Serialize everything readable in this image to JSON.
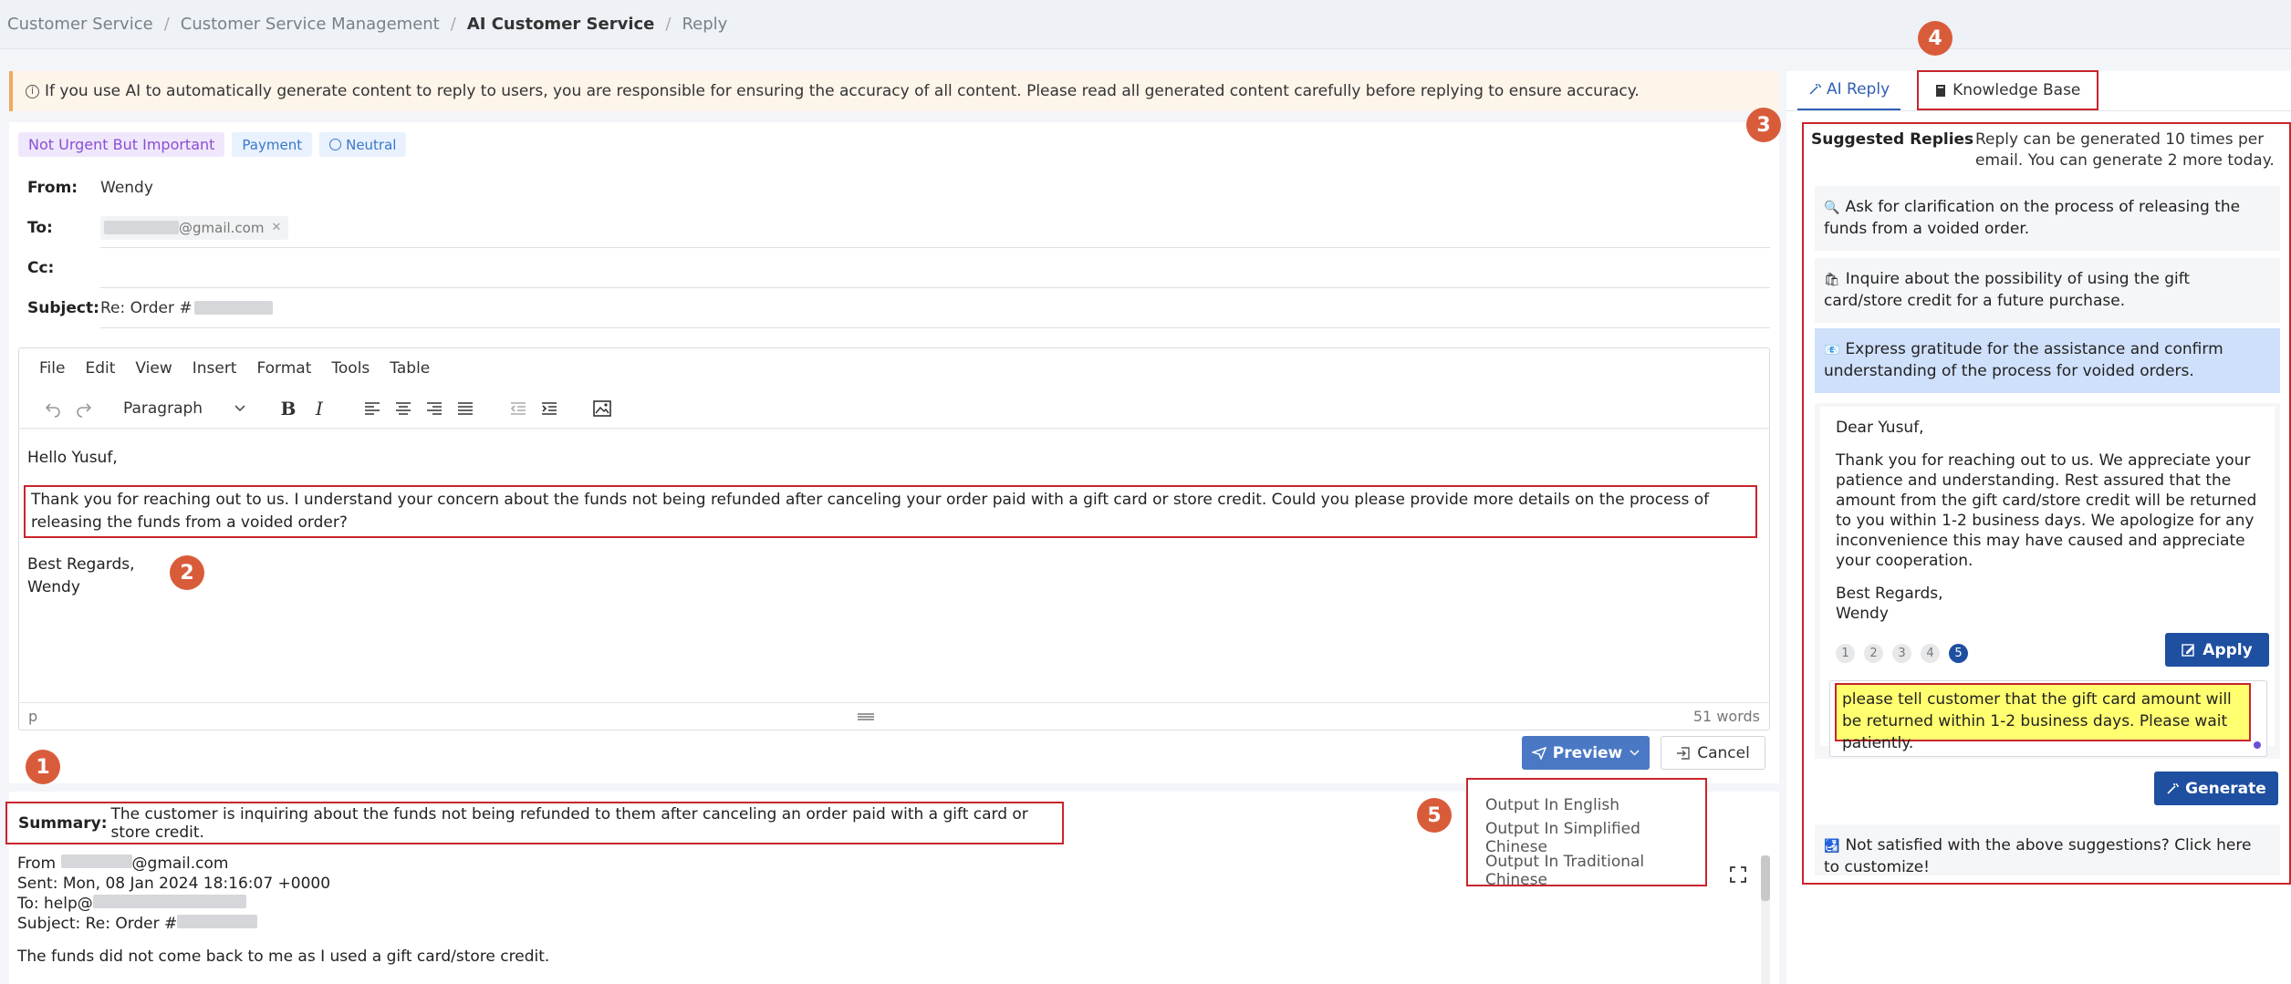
{
  "breadcrumb": {
    "items": [
      "Customer Service",
      "Customer Service Management",
      "AI Customer Service",
      "Reply"
    ]
  },
  "notice": {
    "text": "If you use AI to automatically generate content to reply to users, you are responsible for ensuring the accuracy of all content. Please read all generated content carefully before replying to ensure accuracy."
  },
  "tags": {
    "priority": "Not Urgent But Important",
    "category": "Payment",
    "sentiment": "Neutral"
  },
  "fields": {
    "from_label": "From:",
    "from_value": "Wendy",
    "to_label": "To:",
    "to_value": "@gmail.com",
    "cc_label": "Cc:",
    "subject_label": "Subject:",
    "subject_value": "Re: Order #"
  },
  "editor": {
    "menu": [
      "File",
      "Edit",
      "View",
      "Insert",
      "Format",
      "Tools",
      "Table"
    ],
    "block_format": "Paragraph",
    "greeting": "Hello Yusuf,",
    "body": "Thank you for reaching out to us. I understand your concern about the funds not being refunded after canceling your order paid with a gift card or store credit. Could you please provide more details on the process of releasing the funds from a voided order?",
    "closing": "Best Regards,",
    "signature": "Wendy",
    "element_path": "p",
    "word_count": "51 words"
  },
  "actions": {
    "preview": "Preview",
    "cancel": "Cancel"
  },
  "preview_menu": {
    "options": [
      "Output In English",
      "Output In Simplified Chinese",
      "Output In Traditional Chinese"
    ]
  },
  "summary": {
    "label": "Summary:",
    "text": "The customer is inquiring about the funds not being refunded to them after canceling an order paid with a gift card or store credit."
  },
  "original_email": {
    "from": "From",
    "from_domain": "@gmail.com",
    "sent": "Sent: Mon, 08 Jan 2024 18:16:07 +0000",
    "to": "To: help@",
    "subject": "Subject: Re: Order #",
    "body": "The funds did not come back to me as I used a gift card/store credit."
  },
  "badges": [
    "1",
    "2",
    "3",
    "4",
    "5"
  ],
  "right_panel": {
    "tab_ai": "AI Reply",
    "tab_kb": "Knowledge Base",
    "suggested_title": "Suggested Replies",
    "quota_text": "Reply can be generated 10 times per email. You can generate 2 more today.",
    "suggestions": [
      {
        "icon": "🔍",
        "text": "Ask for clarification on the process of releasing the funds from a voided order."
      },
      {
        "icon": "🛍",
        "text": "Inquire about the possibility of using the gift card/store credit for a future purchase."
      },
      {
        "icon": "📧",
        "text": "Express gratitude for the assistance and confirm understanding of the process for voided orders."
      }
    ],
    "reply": {
      "greeting": "Dear Yusuf,",
      "body": "Thank you for reaching out to us. We appreciate your patience and understanding. Rest assured that the amount from the gift card/store credit will be returned to you within 1-2 business days. We apologize for any inconvenience this may have caused and appreciate your cooperation.",
      "closing": "Best Regards,",
      "signature": "Wendy",
      "pages": [
        "1",
        "2",
        "3",
        "4",
        "5"
      ],
      "active_page": 5,
      "apply": "Apply"
    },
    "custom_prompt": "please tell customer that the gift card amount will be returned within 1-2 business days.  Please wait patiently.",
    "generate": "Generate",
    "customize_icon": "🛃",
    "customize_text": "Not satisfied with the above suggestions? Click here to customize!"
  },
  "colors": {
    "primary": "#1e4fa0",
    "preview_btn": "#4a78c4",
    "highlight_border": "#c9252c",
    "badge": "#d95c3a",
    "selected_suggestion": "#cfe0fb"
  }
}
